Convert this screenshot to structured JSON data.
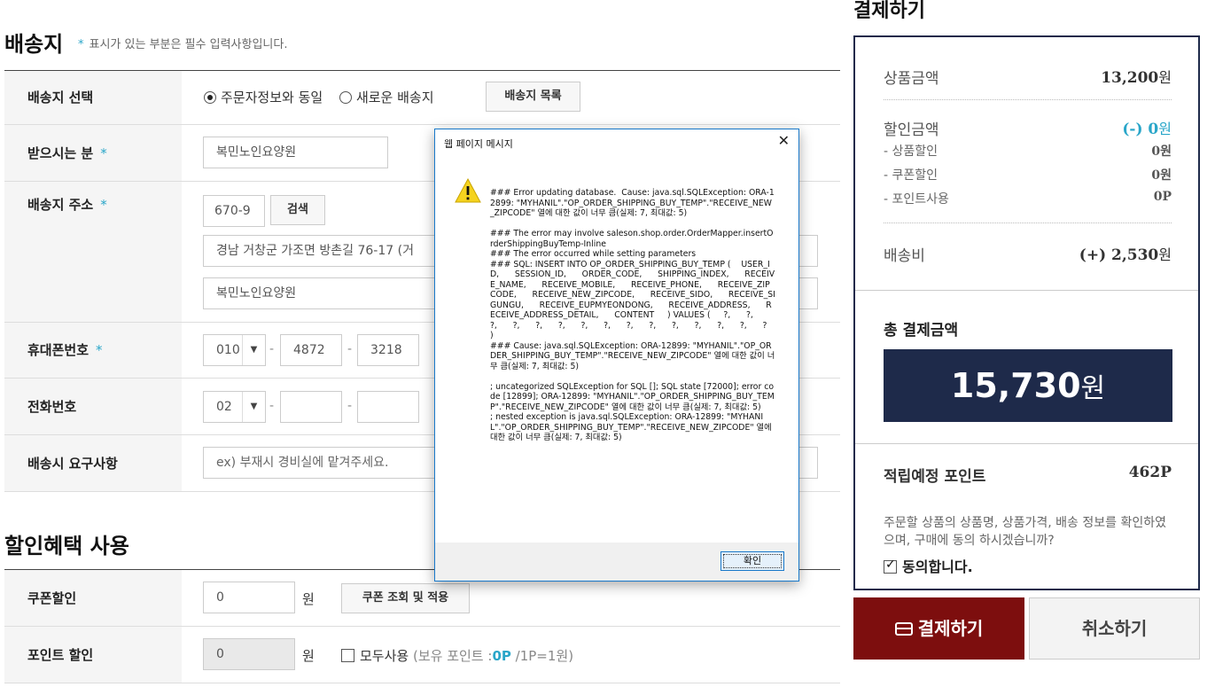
{
  "shipping": {
    "title": "배송지",
    "note_star": "*",
    "note": "표시가 있는 부분은 필수 입력사항입니다.",
    "required_mark": "*",
    "rows": {
      "select": {
        "label": "배송지 선택",
        "option_same": "주문자정보와 동일",
        "option_new": "새로운 배송지",
        "list_button": "배송지 목록"
      },
      "recipient": {
        "label": "받으시는 분",
        "value": "복민노인요양원"
      },
      "address": {
        "label": "배송지 주소",
        "zipcode": "670-9",
        "search_button": "검색",
        "line1": "경남 거창군 가조면 방촌길 76-17 (거",
        "line2": "복민노인요양원"
      },
      "mobile": {
        "label": "휴대폰번호",
        "part1": "010",
        "part2": "4872",
        "part3": "3218"
      },
      "phone": {
        "label": "전화번호",
        "part1": "02",
        "part2": "",
        "part3": ""
      },
      "request": {
        "label": "배송시 요구사항",
        "placeholder": "ex) 부재시 경비실에 맡겨주세요."
      },
      "dash": "-"
    }
  },
  "discount": {
    "title": "할인혜택 사용",
    "coupon": {
      "label": "쿠폰할인",
      "value": "0",
      "unit": "원",
      "button": "쿠폰 조회 및 적용"
    },
    "point": {
      "label": "포인트 할인",
      "value": "0",
      "unit": "원",
      "use_all": "모두사용",
      "hold_prefix": "(보유 포인트 :",
      "hold_value": "0P",
      "hold_suffix": "/1P=1원)"
    }
  },
  "summary": {
    "title": "결제하기",
    "product_label": "상품금액",
    "product_value": "13,200",
    "won": "원",
    "discount_label": "할인금액",
    "discount_value": "(-) 0",
    "sub_product_label": "- 상품할인",
    "sub_product_value": "0원",
    "sub_coupon_label": "- 쿠폰할인",
    "sub_coupon_value": "0원",
    "sub_point_label": "- 포인트사용",
    "sub_point_value": "0P",
    "shipping_label": "배송비",
    "shipping_value": "(+) 2,530",
    "total_label": "총 결제금액",
    "total_value": "15,730",
    "point_label": "적립예정 포인트",
    "point_value": "462P",
    "agree_text": "주문할 상품의 상품명, 상품가격, 배송 정보를 확인하였으며, 구매에 동의 하시겠습니까?",
    "agree_label": "동의합니다.",
    "pay_button": "결제하기",
    "cancel_button": "취소하기"
  },
  "dialog": {
    "title": "웹 페이지 메시지",
    "close": "✕",
    "ok_button": "확인",
    "message": "### Error updating database.  Cause: java.sql.SQLException: ORA-12899: \"MYHANIL\".\"OP_ORDER_SHIPPING_BUY_TEMP\".\"RECEIVE_NEW_ZIPCODE\" 열에 대한 값이 너무 큼(실제: 7, 최대값: 5)\n\n### The error may involve saleson.shop.order.OrderMapper.insertOrderShippingBuyTemp-Inline\n### The error occurred while setting parameters\n### SQL: INSERT INTO OP_ORDER_SHIPPING_BUY_TEMP (    USER_ID,      SESSION_ID,      ORDER_CODE,      SHIPPING_INDEX,      RECEIVE_NAME,      RECEIVE_MOBILE,      RECEIVE_PHONE,      RECEIVE_ZIPCODE,      RECEIVE_NEW_ZIPCODE,      RECEIVE_SIDO,      RECEIVE_SIGUNGU,      RECEIVE_EUPMYEONDONG,      RECEIVE_ADDRESS,      RECEIVE_ADDRESS_DETAIL,      CONTENT     ) VALUES (     ?,      ?,      ?,      ?,      ?,      ?,      ?,      ?,      ?,      ?,      ?,      ?,      ?,      ?,      ?     )\n### Cause: java.sql.SQLException: ORA-12899: \"MYHANIL\".\"OP_ORDER_SHIPPING_BUY_TEMP\".\"RECEIVE_NEW_ZIPCODE\" 열에 대한 값이 너무 큼(실제: 7, 최대값: 5)\n\n; uncategorized SQLException for SQL []; SQL state [72000]; error code [12899]; ORA-12899: \"MYHANIL\".\"OP_ORDER_SHIPPING_BUY_TEMP\".\"RECEIVE_NEW_ZIPCODE\" 열에 대한 값이 너무 큼(실제: 7, 최대값: 5)\n; nested exception is java.sql.SQLException: ORA-12899: \"MYHANIL\".\"OP_ORDER_SHIPPING_BUY_TEMP\".\"RECEIVE_NEW_ZIPCODE\" 열에 대한 값이 너무 큼(실제: 7, 최대값: 5)"
  },
  "icons": {
    "warning": "warning-icon",
    "card": "card-icon",
    "select_arrow": "chevron-down-icon"
  },
  "colors": {
    "accent": "#2aa6c9",
    "navy": "#1e2a4a",
    "pay": "#7d0e0e"
  }
}
